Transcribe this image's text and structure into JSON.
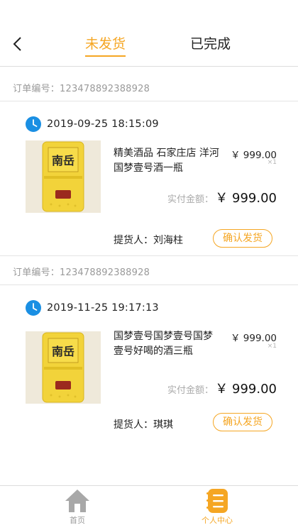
{
  "header": {
    "tabs": [
      {
        "label": "未发货",
        "active": true
      },
      {
        "label": "已完成",
        "active": false
      }
    ]
  },
  "orders": [
    {
      "order_no": "订单编号：123478892388928",
      "time": "2019-09-25  18:15:09",
      "product_name": "精美酒品 石家庄店 洋河国梦壹号酒一瓶",
      "price": "￥ 999.00",
      "qty": "×1",
      "paid_label": "实付金额：",
      "paid_amount": "￥ 999.00",
      "picker": "提货人：刘海柱",
      "confirm": "确认发货",
      "bottle_text": "南岳"
    },
    {
      "order_no": "订单编号：123478892388928",
      "time": "2019-11-25  19:17:13",
      "product_name": "国梦壹号国梦壹号国梦壹号好喝的酒三瓶",
      "price": "￥ 999.00",
      "qty": "×1",
      "paid_label": "实付金额：",
      "paid_amount": "￥ 999.00",
      "picker": "提货人：琪琪",
      "confirm": "确认发货",
      "bottle_text": "南岳"
    }
  ],
  "tabbar": {
    "items": [
      {
        "label": "首页",
        "icon": "home-icon",
        "active": false
      },
      {
        "label": "个人中心",
        "icon": "profile-list-icon",
        "active": true
      }
    ]
  },
  "colors": {
    "accent": "#f5a623",
    "clock": "#1a8fe3",
    "inactive": "#9a9a9a"
  }
}
